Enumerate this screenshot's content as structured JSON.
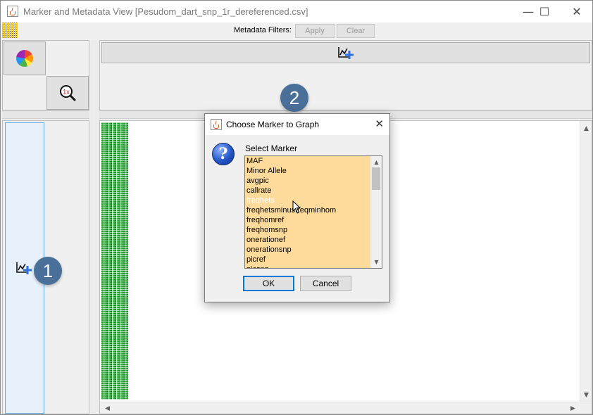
{
  "window": {
    "title": "Marker and Metadata View [Pesudom_dart_snp_1r_dereferenced.csv]",
    "controls": {
      "minimize": "—",
      "maximize": "☐",
      "close": "✕"
    }
  },
  "filters": {
    "label": "Metadata Filters:",
    "apply": "Apply",
    "clear": "Clear"
  },
  "tools": {
    "palette_icon": "color-wheel-icon",
    "zoom_label": "1x"
  },
  "badges": {
    "one": "1",
    "two": "2"
  },
  "dialog": {
    "title": "Choose Marker to Graph",
    "prompt": "Select Marker",
    "items": [
      "MAF",
      "Minor Allele",
      "avgpic",
      "callrate",
      "freqhets",
      "freqhetsminusfreqminhom",
      "freqhomref",
      "freqhomsnp",
      "onerationef",
      "onerationsnp",
      "picref",
      "picsnp"
    ],
    "selected_index": 4,
    "ok": "OK",
    "cancel": "Cancel"
  },
  "colors": {
    "list_bg": "#fedb9a",
    "badge": "#4a6f98",
    "accent": "#0078d7",
    "heat_green": "#1f9e2b"
  }
}
